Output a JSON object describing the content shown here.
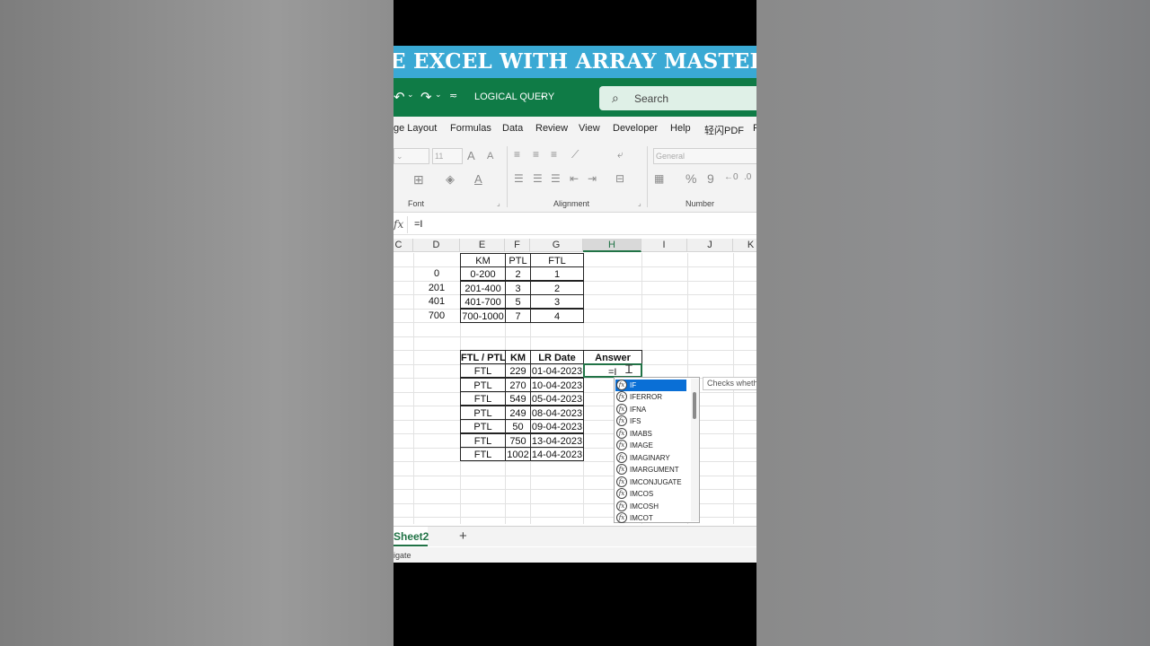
{
  "banner": {
    "text": "E EXCEL WITH ARRAY MASTERY"
  },
  "titlebar": {
    "undo_icon": "undo-icon",
    "redo_icon": "redo-icon",
    "document_name": "LOGICAL QUERY",
    "search_placeholder": "Search"
  },
  "menu": [
    "ge Layout",
    "Formulas",
    "Data",
    "Review",
    "View",
    "Developer",
    "Help",
    "轻闪PDF",
    "F"
  ],
  "ribbon": {
    "font_size": "11",
    "number_format": "General",
    "groups": {
      "font": "Font",
      "alignment": "Alignment",
      "number": "Number"
    },
    "percent": "%",
    "comma": "9",
    "increase_font": "A",
    "decrease_font": "A",
    "font_color_letter": "A"
  },
  "formula_bar": {
    "fx": "fx",
    "value": "=I"
  },
  "columns": [
    "C",
    "D",
    "E",
    "F",
    "G",
    "H",
    "I",
    "J",
    "K"
  ],
  "active_column": "H",
  "lookup_table": {
    "headers": [
      "KM",
      "PTL",
      "FTL"
    ],
    "from": [
      "0",
      "201",
      "401",
      "700"
    ],
    "rows": [
      [
        "0-200",
        "2",
        "1"
      ],
      [
        "201-400",
        "3",
        "2"
      ],
      [
        "401-700",
        "5",
        "3"
      ],
      [
        "700-1000",
        "7",
        "4"
      ]
    ]
  },
  "data_table": {
    "headers": [
      "FTL / PTL",
      "KM",
      "LR Date",
      "Answer"
    ],
    "rows": [
      [
        "FTL",
        "229",
        "01-04-2023",
        "=I"
      ],
      [
        "PTL",
        "270",
        "10-04-2023",
        ""
      ],
      [
        "FTL",
        "549",
        "05-04-2023",
        ""
      ],
      [
        "PTL",
        "249",
        "08-04-2023",
        ""
      ],
      [
        "PTL",
        "50",
        "09-04-2023",
        ""
      ],
      [
        "FTL",
        "750",
        "13-04-2023",
        ""
      ],
      [
        "FTL",
        "1002",
        "14-04-2023",
        ""
      ]
    ]
  },
  "autocomplete": {
    "items": [
      "IF",
      "IFERROR",
      "IFNA",
      "IFS",
      "IMABS",
      "IMAGE",
      "IMAGINARY",
      "IMARGUMENT",
      "IMCONJUGATE",
      "IMCOS",
      "IMCOSH",
      "IMCOT"
    ],
    "selected_index": 0,
    "tooltip": "Checks wheth"
  },
  "sheet_tab": "Sheet2",
  "add_sheet": "+",
  "status_text": "igate"
}
